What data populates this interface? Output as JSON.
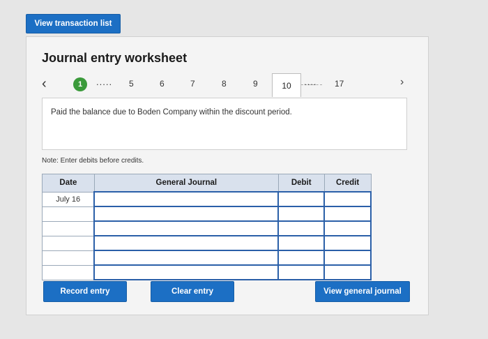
{
  "top_button": {
    "label": "View transaction list"
  },
  "worksheet": {
    "title": "Journal entry worksheet",
    "nav": {
      "active_step": "1",
      "dots_left": ".....",
      "steps": [
        "5",
        "6",
        "7",
        "8",
        "9"
      ],
      "current_tab": "10",
      "dots_right": "....",
      "last_step": "17"
    },
    "description": "Paid the balance due to Boden Company within the discount period.",
    "note": "Note: Enter debits before credits.",
    "table": {
      "headers": {
        "date": "Date",
        "journal": "General Journal",
        "debit": "Debit",
        "credit": "Credit"
      },
      "rows": [
        {
          "date": "July 16"
        },
        {
          "date": ""
        },
        {
          "date": ""
        },
        {
          "date": ""
        },
        {
          "date": ""
        },
        {
          "date": ""
        }
      ]
    },
    "buttons": {
      "record": "Record entry",
      "clear": "Clear entry",
      "view_journal": "View general journal"
    }
  },
  "colors": {
    "primary": "#1c6fc4",
    "active_step": "#3b9a3b",
    "table_header": "#d9e1ed",
    "input_border": "#2a5fa8"
  }
}
